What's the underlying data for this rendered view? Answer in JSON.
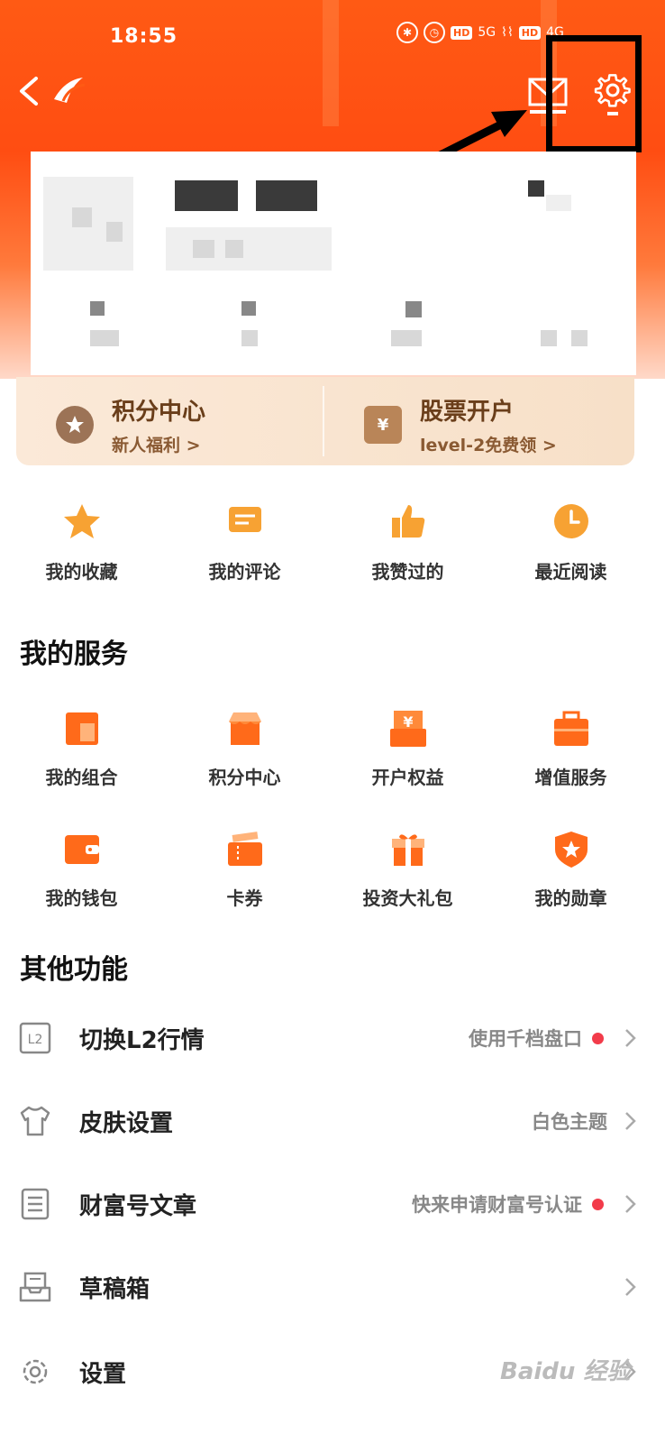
{
  "status_bar": {
    "time": "18:55",
    "hd1": "HD",
    "hd2": "HD",
    "net1": "5G",
    "net2": "4G"
  },
  "colors": {
    "brand": "#ff5a14",
    "accent": "#f7a233",
    "dot": "#f23b4a"
  },
  "banner": {
    "left": {
      "title": "积分中心",
      "subtitle": "新人福利 >"
    },
    "right": {
      "title": "股票开户",
      "subtitle": "level-2免费领 >"
    }
  },
  "quick_actions": [
    {
      "label": "我的收藏",
      "icon": "star-icon"
    },
    {
      "label": "我的评论",
      "icon": "comment-icon"
    },
    {
      "label": "我赞过的",
      "icon": "thumbs-up-icon"
    },
    {
      "label": "最近阅读",
      "icon": "clock-icon"
    }
  ],
  "services": {
    "title": "我的服务",
    "row1": [
      {
        "label": "我的组合",
        "icon": "portfolio-icon"
      },
      {
        "label": "积分中心",
        "icon": "shop-icon"
      },
      {
        "label": "开户权益",
        "icon": "yen-box-icon"
      },
      {
        "label": "增值服务",
        "icon": "briefcase-icon"
      }
    ],
    "row2": [
      {
        "label": "我的钱包",
        "icon": "wallet-icon"
      },
      {
        "label": "卡券",
        "icon": "ticket-icon"
      },
      {
        "label": "投资大礼包",
        "icon": "gift-icon"
      },
      {
        "label": "我的勋章",
        "icon": "medal-icon"
      }
    ]
  },
  "other": {
    "title": "其他功能",
    "items": [
      {
        "label": "切换L2行情",
        "status": "使用千档盘口",
        "dot": true,
        "icon": "l2-icon"
      },
      {
        "label": "皮肤设置",
        "status": "白色主题",
        "dot": false,
        "icon": "shirt-icon"
      },
      {
        "label": "财富号文章",
        "status": "快来申请财富号认证",
        "dot": true,
        "icon": "document-icon"
      },
      {
        "label": "草稿箱",
        "status": "",
        "dot": false,
        "icon": "drafts-icon"
      },
      {
        "label": "设置",
        "status": "",
        "dot": false,
        "icon": "gear-icon"
      }
    ]
  },
  "watermark": "Baidu 经验"
}
